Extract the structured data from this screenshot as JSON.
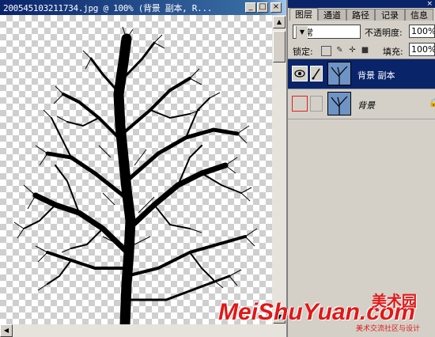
{
  "document": {
    "title": "200545103211734.jpg @ 100% (背景 副本, R..."
  },
  "layers_panel": {
    "tabs": [
      "图层",
      "通道",
      "路径",
      "记录",
      "信息"
    ],
    "blend_mode": "正常",
    "opacity_label": "不透明度:",
    "opacity_value": "100%",
    "lock_label": "锁定:",
    "fill_label": "填充:",
    "fill_value": "100%",
    "layers": [
      {
        "name": "背景 副本",
        "selected": true,
        "visible": true,
        "italic": false
      },
      {
        "name": "背景",
        "selected": false,
        "visible": false,
        "italic": true
      }
    ]
  },
  "watermark": {
    "latin": "MeiShuYuan.com",
    "chinese": "美术园",
    "sub": "美术交流社区与设计"
  },
  "icons": [
    "minimize-icon",
    "maximize-icon",
    "close-icon",
    "eye-icon",
    "brush-icon",
    "lock-icon"
  ]
}
